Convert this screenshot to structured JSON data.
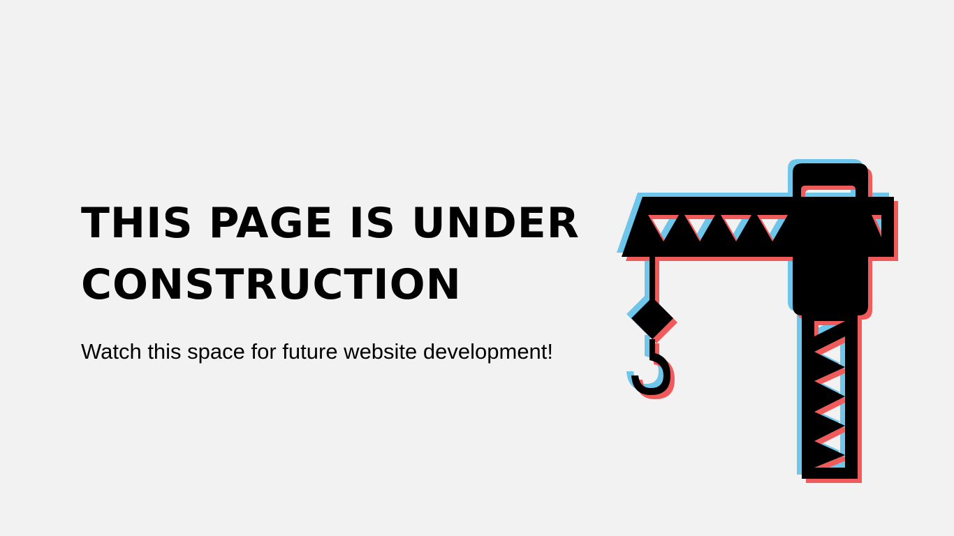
{
  "headline": {
    "line1": "THIS PAGE IS UNDER",
    "line2": "CONSTRUCTION"
  },
  "tagline": "Watch this space for future website development!",
  "illustration": {
    "icon": "crane-icon",
    "colors": {
      "main": "#000000",
      "offset_cyan": "#6ec6ea",
      "offset_red": "#ef5a5a",
      "background": "#f2f2f2"
    }
  }
}
